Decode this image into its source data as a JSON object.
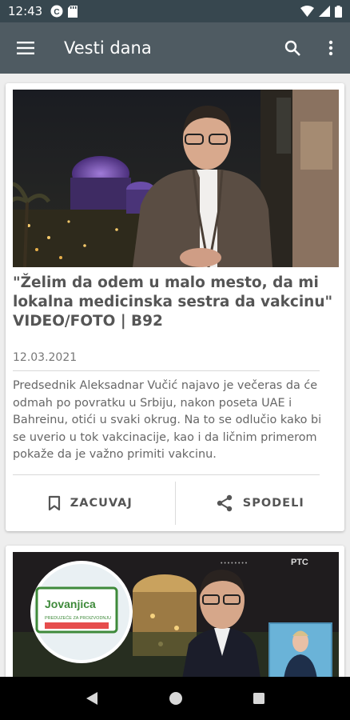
{
  "status_bar": {
    "time": "12:43",
    "left_icons": [
      "app-notification-icon",
      "storage-icon"
    ],
    "right_icons": [
      "wifi-icon",
      "signal-icon",
      "battery-icon"
    ]
  },
  "app_bar": {
    "title": "Vesti dana",
    "menu_icon": "hamburger-menu-icon",
    "search_icon": "search-icon",
    "overflow_icon": "more-vert-icon"
  },
  "articles": [
    {
      "title": "\"Želim da odem u malo mesto, da mi lokalna medicinska sestra da vakcinu\" VIDEO/FOTO | B92",
      "date": "12.03.2021",
      "summary": "Predsednik Aleksadnar Vučić najavo je večeras da će odmah po povratku u Srbiju, nakon poseta UAE i Bahreinu, otići u svaki okrug. Na to se odlučio kako bi se uverio u tok vakcinacije, kao i da ličnim primerom pokaže da je važno primiti vakcinu.",
      "save_label": "ZACUVAJ",
      "share_label": "SPODELI"
    },
    {
      "image_sign_text": "Jovanjica",
      "image_sign_subtext": "PREDUZEĆE ZA PROIZVODNJU",
      "image_watermark": "РТС"
    }
  ],
  "colors": {
    "status_bar": "#37474f",
    "app_bar": "#4f5b62",
    "background": "#eeeeee",
    "card": "#ffffff",
    "title_text": "#555555"
  },
  "nav_bar": {
    "back_icon": "back-icon",
    "home_icon": "home-icon",
    "recents_icon": "recents-icon"
  }
}
